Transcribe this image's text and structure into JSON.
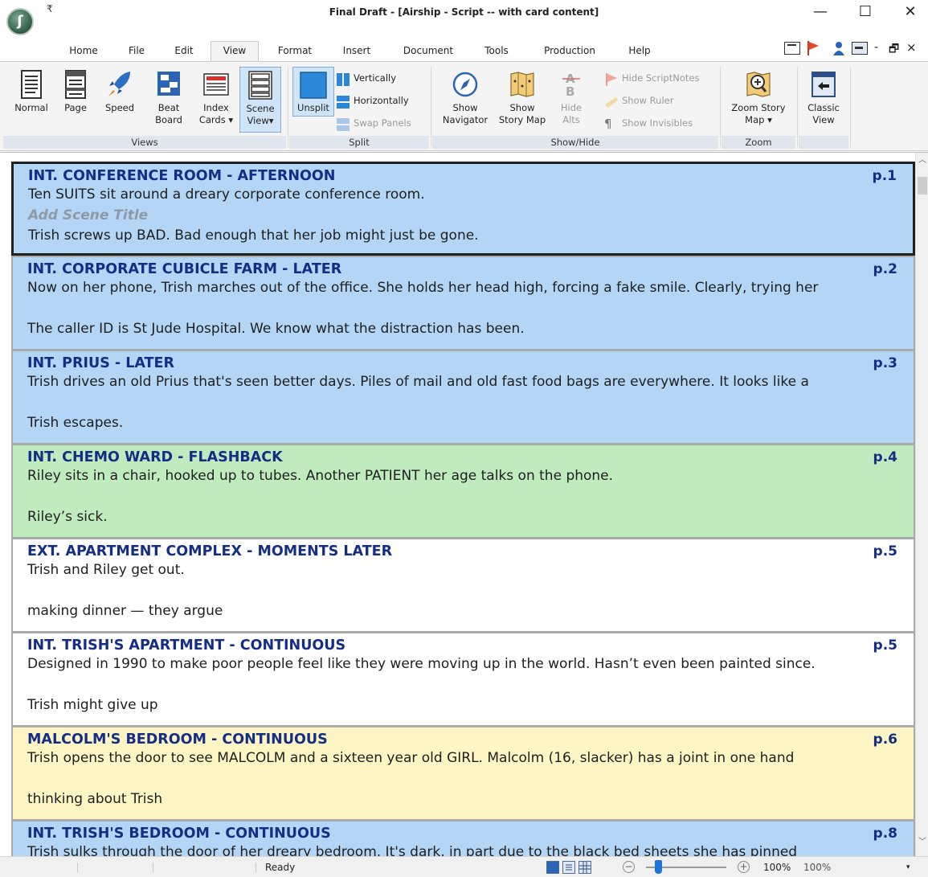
{
  "window": {
    "title": "Final Draft - [Airship - Script -- with card content]",
    "app_icon": "final-draft-logo",
    "qat_glyph": "₹",
    "minimize": "—",
    "maximize": "☐",
    "close": "✕"
  },
  "menu": {
    "tabs": [
      {
        "label": "Home",
        "active": false
      },
      {
        "label": "File",
        "active": false
      },
      {
        "label": "Edit",
        "active": false
      },
      {
        "label": "View",
        "active": true
      },
      {
        "label": "Format",
        "active": false
      },
      {
        "label": "Insert",
        "active": false
      },
      {
        "label": "Document",
        "active": false
      },
      {
        "label": "Tools",
        "active": false
      },
      {
        "label": "Production",
        "active": false
      },
      {
        "label": "Help",
        "active": false
      }
    ],
    "doc_minimize": "-",
    "doc_restore": "🗗",
    "doc_close": "×"
  },
  "ribbon": {
    "views": {
      "label": "Views",
      "normal": "Normal",
      "page": "Page",
      "speed": "Speed",
      "beat_board_1": "Beat",
      "beat_board_2": "Board",
      "index_cards_1": "Index",
      "index_cards_2": "Cards ▾",
      "scene_view_1": "Scene",
      "scene_view_2": "View▾"
    },
    "split": {
      "label": "Split",
      "unsplit": "Unsplit",
      "vertically": "Vertically",
      "horizontally": "Horizontally",
      "swap_panels": "Swap Panels"
    },
    "show_hide": {
      "label": "Show/Hide",
      "show_navigator_1": "Show",
      "show_navigator_2": "Navigator",
      "show_story_map_1": "Show",
      "show_story_map_2": "Story Map",
      "hide_alts_1": "Hide",
      "hide_alts_2": "Alts",
      "hide_scriptnotes": "Hide ScriptNotes",
      "show_ruler": "Show Ruler",
      "show_invisibles": "Show Invisibles"
    },
    "zoom": {
      "label": "Zoom",
      "zoom_story_map_1": "Zoom Story",
      "zoom_story_map_2": "Map ▾"
    },
    "classic": {
      "classic_view_1": "Classic",
      "classic_view_2": "View"
    }
  },
  "scenes": [
    {
      "heading": "INT. CONFERENCE ROOM - AFTERNOON",
      "page": "p.1",
      "color": "blue",
      "selected": true,
      "line1": "Ten SUITS sit around a dreary corporate conference room.",
      "placeholder": "Add Scene Title",
      "line2": "Trish screws up BAD. Bad enough that her job might just be gone."
    },
    {
      "heading": "INT. CORPORATE CUBICLE FARM - LATER",
      "page": "p.2",
      "color": "blue",
      "line1": "Now on her phone, Trish marches out of the office. She holds her head high, forcing a fake smile. Clearly, trying her",
      "line2": "The caller ID is St Jude Hospital. We know what the distraction has been."
    },
    {
      "heading": "INT. PRIUS - LATER",
      "page": "p.3",
      "color": "blue",
      "line1": "Trish drives an old Prius that's seen better days. Piles of mail and old fast food bags are everywhere. It looks like a",
      "line2": "Trish escapes."
    },
    {
      "heading": "INT. CHEMO WARD - FLASHBACK",
      "page": "p.4",
      "color": "green",
      "line1": "Riley sits in a chair, hooked up to tubes. Another PATIENT her age talks on the phone.",
      "line2": "Riley’s sick."
    },
    {
      "heading": "EXT. APARTMENT COMPLEX - MOMENTS LATER",
      "page": "p.5",
      "color": "white",
      "line1": "Trish and Riley get out.",
      "line2": "making dinner — they argue"
    },
    {
      "heading": "INT. TRISH'S APARTMENT - CONTINUOUS",
      "page": "p.5",
      "color": "white",
      "line1": "Designed in 1990 to make poor people feel like they were moving up in the world. Hasn’t even been painted since.",
      "line2": "Trish might give up"
    },
    {
      "heading": "MALCOLM'S BEDROOM - CONTINUOUS",
      "page": "p.6",
      "color": "yellow",
      "line1": "Trish opens the door to see MALCOLM and a sixteen year old GIRL. Malcolm (16, slacker) has a joint in one hand",
      "line2": "thinking about Trish"
    },
    {
      "heading": "INT. TRISH'S BEDROOM - CONTINUOUS",
      "page": "p.8",
      "color": "blue",
      "line1": "Trish sulks through the door of her dreary bedroom. It's dark, in part due to the black bed sheets she has pinned",
      "line2": ""
    }
  ],
  "statusbar": {
    "status": "Ready",
    "zoom_minus": "−",
    "zoom_plus": "+",
    "zoom_level": 1.0,
    "zoom_text": "100%",
    "zoom_box": "100%"
  }
}
